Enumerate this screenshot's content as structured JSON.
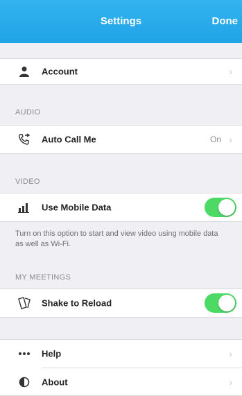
{
  "nav": {
    "title": "Settings",
    "done_label": "Done"
  },
  "account": {
    "label": "Account"
  },
  "audio": {
    "header": "AUDIO",
    "auto_call": {
      "label": "Auto Call Me",
      "value": "On"
    }
  },
  "video": {
    "header": "VIDEO",
    "mobile_data": {
      "label": "Use Mobile Data",
      "on": true
    },
    "footnote": "Turn on this option to start and view video using mobile data as well as Wi-Fi."
  },
  "meetings": {
    "header": "MY MEETINGS",
    "shake": {
      "label": "Shake to Reload",
      "on": true
    }
  },
  "help": {
    "label": "Help"
  },
  "about": {
    "label": "About"
  },
  "colors": {
    "accent": "#1fa3e6",
    "toggle_on": "#4cd964"
  },
  "icons": [
    "person-icon",
    "auto-call-icon",
    "signal-bars-icon",
    "shake-icon",
    "more-dots-icon",
    "about-icon",
    "chevron-right-icon"
  ]
}
